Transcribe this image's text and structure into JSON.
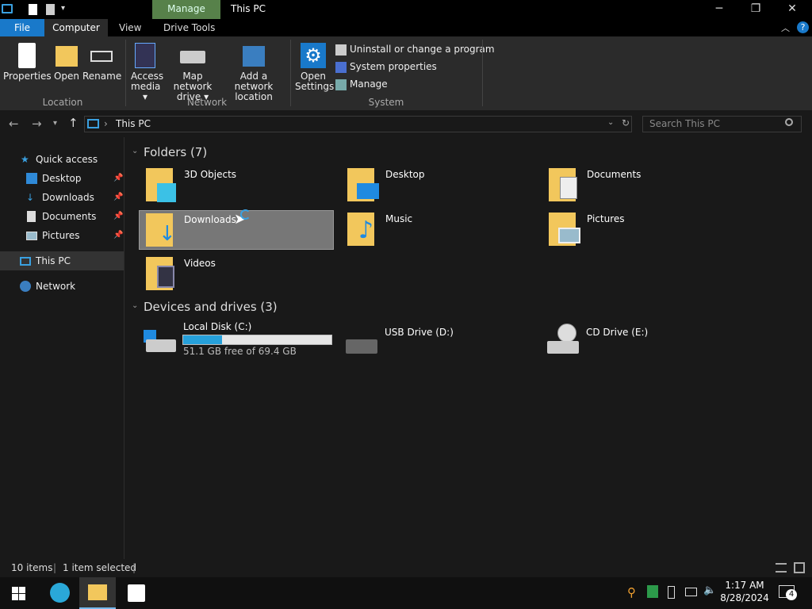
{
  "window": {
    "title": "This PC",
    "context_tab": "Manage",
    "minimize": "─",
    "restore": "❐",
    "close": "✕"
  },
  "tabs": {
    "file": "File",
    "computer": "Computer",
    "view": "View",
    "drive_tools": "Drive Tools"
  },
  "ribbon": {
    "location": {
      "group": "Location",
      "properties": "Properties",
      "open": "Open",
      "rename": "Rename"
    },
    "network": {
      "group": "Network",
      "access_media": "Access media ▾",
      "map_drive": "Map network drive ▾",
      "add_location": "Add a network location"
    },
    "system": {
      "group": "System",
      "open_settings": "Open Settings",
      "uninstall": "Uninstall or change a program",
      "sys_props": "System properties",
      "manage": "Manage"
    }
  },
  "address": {
    "path": "This PC",
    "sep": "›",
    "search_placeholder": "Search This PC"
  },
  "sidebar": {
    "quick_access": "Quick access",
    "items": [
      {
        "label": "Desktop"
      },
      {
        "label": "Downloads"
      },
      {
        "label": "Documents"
      },
      {
        "label": "Pictures"
      }
    ],
    "this_pc": "This PC",
    "network": "Network"
  },
  "content": {
    "folders_header": "Folders (7)",
    "folders": [
      {
        "label": "3D Objects"
      },
      {
        "label": "Desktop"
      },
      {
        "label": "Documents"
      },
      {
        "label": "Downloads"
      },
      {
        "label": "Music"
      },
      {
        "label": "Pictures"
      },
      {
        "label": "Videos"
      }
    ],
    "drives_header": "Devices and drives (3)",
    "drives": [
      {
        "label": "Local Disk (C:)",
        "free": "51.1 GB free of 69.4 GB",
        "used_fraction": 0.264
      },
      {
        "label": "USB Drive (D:)"
      },
      {
        "label": "CD Drive (E:)"
      }
    ]
  },
  "status": {
    "count": "10 items",
    "selected": "1 item selected"
  },
  "taskbar": {
    "time": "1:17 AM",
    "date": "8/28/2024",
    "notifications": "4"
  },
  "colors": {
    "accent": "#1979ca",
    "manage_tab": "#57814a",
    "selection": "#777777",
    "folder": "#f2c75c"
  }
}
